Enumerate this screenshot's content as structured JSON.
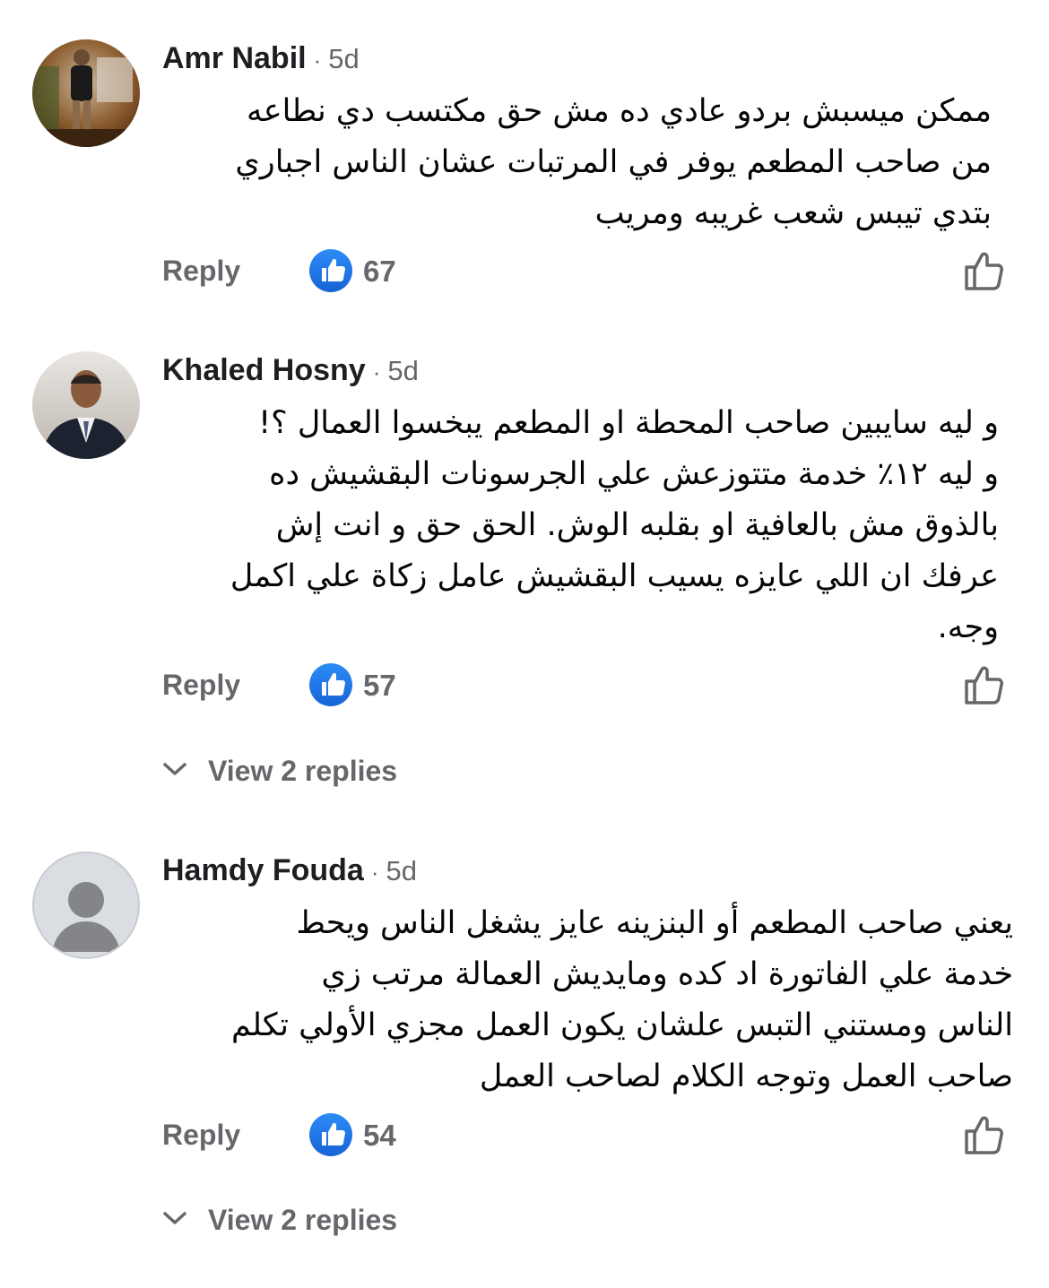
{
  "comments": [
    {
      "name": "Amr Nabil",
      "time": "5d",
      "lines": [
        "ممكن ميسبش بردو عادي ده مش حق مكتسب دي نطاعه",
        "من صاحب المطعم يوفر في المرتبات عشان الناس اجباري",
        "بتدي تيبس شعب غريبه ومريب"
      ],
      "reply_label": "Reply",
      "likes": "67"
    },
    {
      "name": "Khaled Hosny",
      "time": "5d",
      "lines": [
        "و ليه سايبين صاحب المحطة او المطعم يبخسوا العمال ؟!",
        "و ليه ١٢٪ خدمة متتوزعش علي الجرسونات  البقشيش ده",
        "بالذوق مش بالعافية او بقلبه الوش. الحق حق و انت إش",
        "عرفك ان اللي عايزه يسيب البقشيش عامل زكاة علي اكمل",
        "وجه."
      ],
      "reply_label": "Reply",
      "likes": "57",
      "view_replies": "View 2 replies"
    },
    {
      "name": "Hamdy Fouda",
      "time": "5d",
      "lines": [
        "يعني صاحب المطعم أو البنزينه عايز يشغل الناس ويحط",
        "خدمة علي الفاتورة اد كده ومايديش العمالة مرتب زي",
        "الناس ومستني التبس علشان يكون العمل مجزي الأولي تكلم",
        "صاحب العمل وتوجه الكلام لصاحب العمل"
      ],
      "reply_label": "Reply",
      "likes": "54",
      "view_replies": "View 2 replies"
    }
  ],
  "icons": {
    "like_badge": "thumbs-up-filled-icon",
    "like_button": "thumbs-up-outline-icon",
    "expand": "chevron-down-icon",
    "default_avatar": "person-silhouette-icon"
  },
  "colors": {
    "like_blue": "#1b74e4",
    "secondary_text": "#65676b"
  }
}
